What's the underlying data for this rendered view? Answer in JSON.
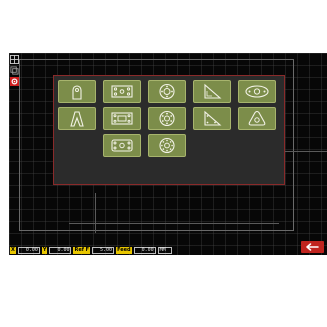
{
  "toolbar": {
    "icons": [
      "grid-icon",
      "layers-icon",
      "settings-icon"
    ]
  },
  "shape_tiles": [
    {
      "name": "arched-tab-shape"
    },
    {
      "name": "rectangle-four-holes-shape"
    },
    {
      "name": "flange-circle-shape"
    },
    {
      "name": "right-triangle-shape"
    },
    {
      "name": "oval-flange-shape"
    },
    {
      "name": "a-frame-shape"
    },
    {
      "name": "rectangle-six-holes-shape"
    },
    {
      "name": "circle-six-holes-shape"
    },
    {
      "name": "triangle-holes-shape"
    },
    {
      "name": "rounded-triangle-shape"
    },
    {
      "name": "rounded-rectangle-holes-shape"
    },
    {
      "name": "circle-eight-holes-shape"
    }
  ],
  "status": {
    "x_label": "X",
    "x_value": "0.00",
    "y_label": "Y",
    "y_value": "0.00",
    "ref_label": "Ref F",
    "ref_value": "5.00",
    "feed_label": "Feed",
    "feed_value": "0.00",
    "unit_value": "MM"
  },
  "actions": {
    "back_icon": "arrow-left-icon"
  }
}
